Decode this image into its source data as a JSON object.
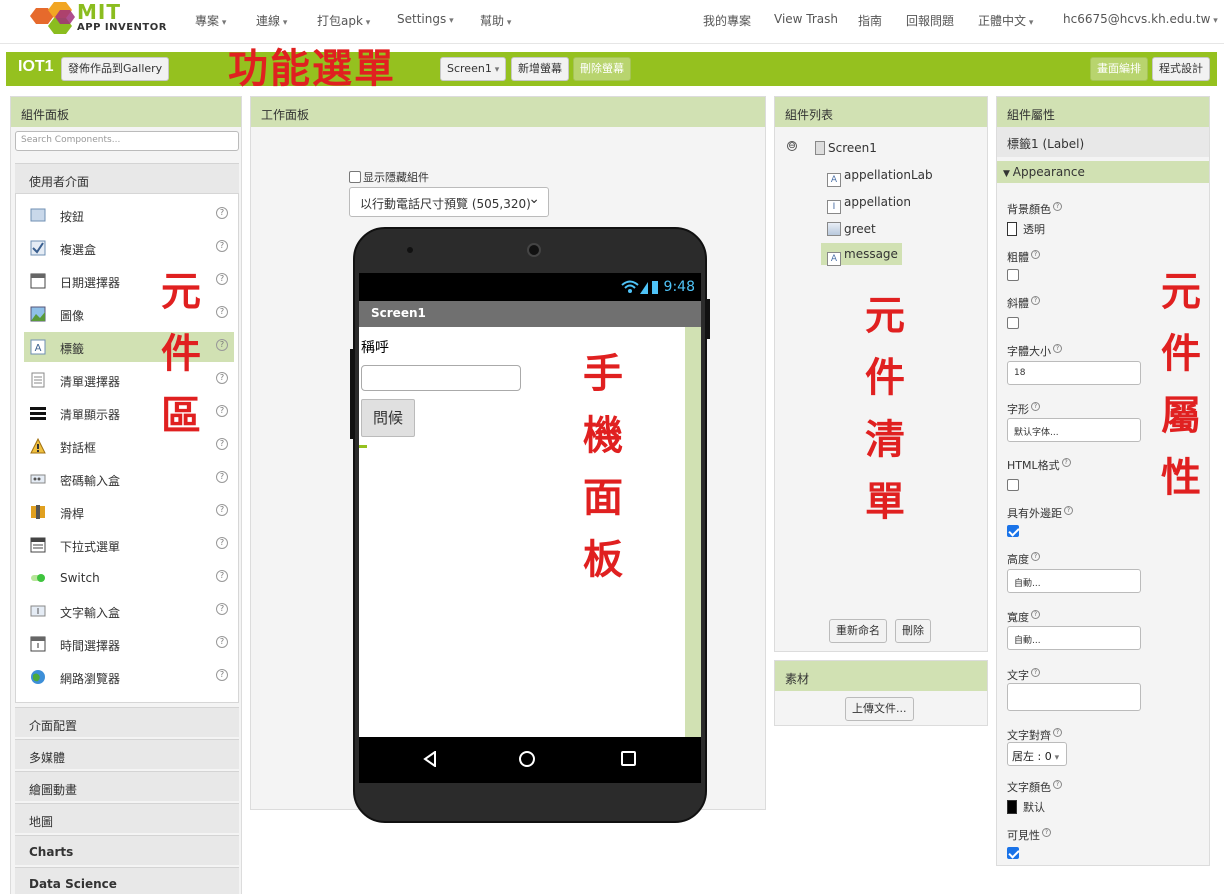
{
  "brand": {
    "mit": "MIT",
    "app_inventor": "APP INVENTOR"
  },
  "topnav": {
    "left": [
      "專案",
      "連線",
      "打包apk",
      "Settings",
      "幫助"
    ],
    "right": [
      "我的專案",
      "View Trash",
      "指南",
      "回報問題",
      "正體中文",
      "hc6675@hcvs.kh.edu.tw"
    ]
  },
  "toolbar": {
    "project": "IOT1",
    "gallery": "發佈作品到Gallery",
    "screen_select": "Screen1",
    "add_screen": "新增螢幕",
    "remove_screen": "刪除螢幕",
    "designer": "畫面編排",
    "blocks": "程式設計",
    "annotation": "功能選單"
  },
  "palette": {
    "title": "組件面板",
    "search_placeholder": "Search Components...",
    "ui_section": "使用者介面",
    "components": [
      "按鈕",
      "複選盒",
      "日期選擇器",
      "圖像",
      "標籤",
      "清單選擇器",
      "清單顯示器",
      "對話框",
      "密碼輸入盒",
      "滑桿",
      "下拉式選單",
      "Switch",
      "文字輸入盒",
      "時間選擇器",
      "網路瀏覽器"
    ],
    "help": "?",
    "categories": [
      "介面配置",
      "多媒體",
      "繪圖動畫",
      "地圖",
      "Charts",
      "Data Science"
    ],
    "annotation": "元件區"
  },
  "viewer": {
    "title": "工作面板",
    "show_hidden": "显示隱藏組件",
    "size_preset": "以行動電話尺寸預覽 (505,320)",
    "status_time": "9:48",
    "screen_title": "Screen1",
    "label_text": "稱呼",
    "button_text": "問候",
    "annotation": "手機面板"
  },
  "tree": {
    "title": "組件列表",
    "collapse": "⊖",
    "nodes": [
      "Screen1",
      "appellationLab",
      "appellation",
      "greet",
      "message"
    ],
    "icon_label": "A",
    "icon_textbox": "I",
    "rename": "重新命名",
    "delete": "刪除",
    "annotation": "元件清單"
  },
  "media": {
    "title": "素材",
    "upload": "上傳文件..."
  },
  "props": {
    "title": "組件屬性",
    "component": "標籤1 (Label)",
    "group": "Appearance",
    "bg_color_label": "背景顏色",
    "bg_color_value": "透明",
    "bold_label": "粗體",
    "italic_label": "斜體",
    "font_size_label": "字體大小",
    "font_size_value": "18",
    "typeface_label": "字形",
    "typeface_value": "默认字体...",
    "html_label": "HTML格式",
    "margin_label": "具有外邊距",
    "height_label": "高度",
    "height_value": "自動...",
    "width_label": "寬度",
    "width_value": "自動...",
    "text_label": "文字",
    "align_label": "文字對齊",
    "align_value": "居左 : 0",
    "text_color_label": "文字顏色",
    "text_color_value": "默认",
    "visible_label": "可見性",
    "q": "?",
    "annotation": "元件屬性"
  },
  "colors": {
    "accent": "#95c11f",
    "panel_head": "#d1e1b3",
    "annotation": "#e02020"
  }
}
